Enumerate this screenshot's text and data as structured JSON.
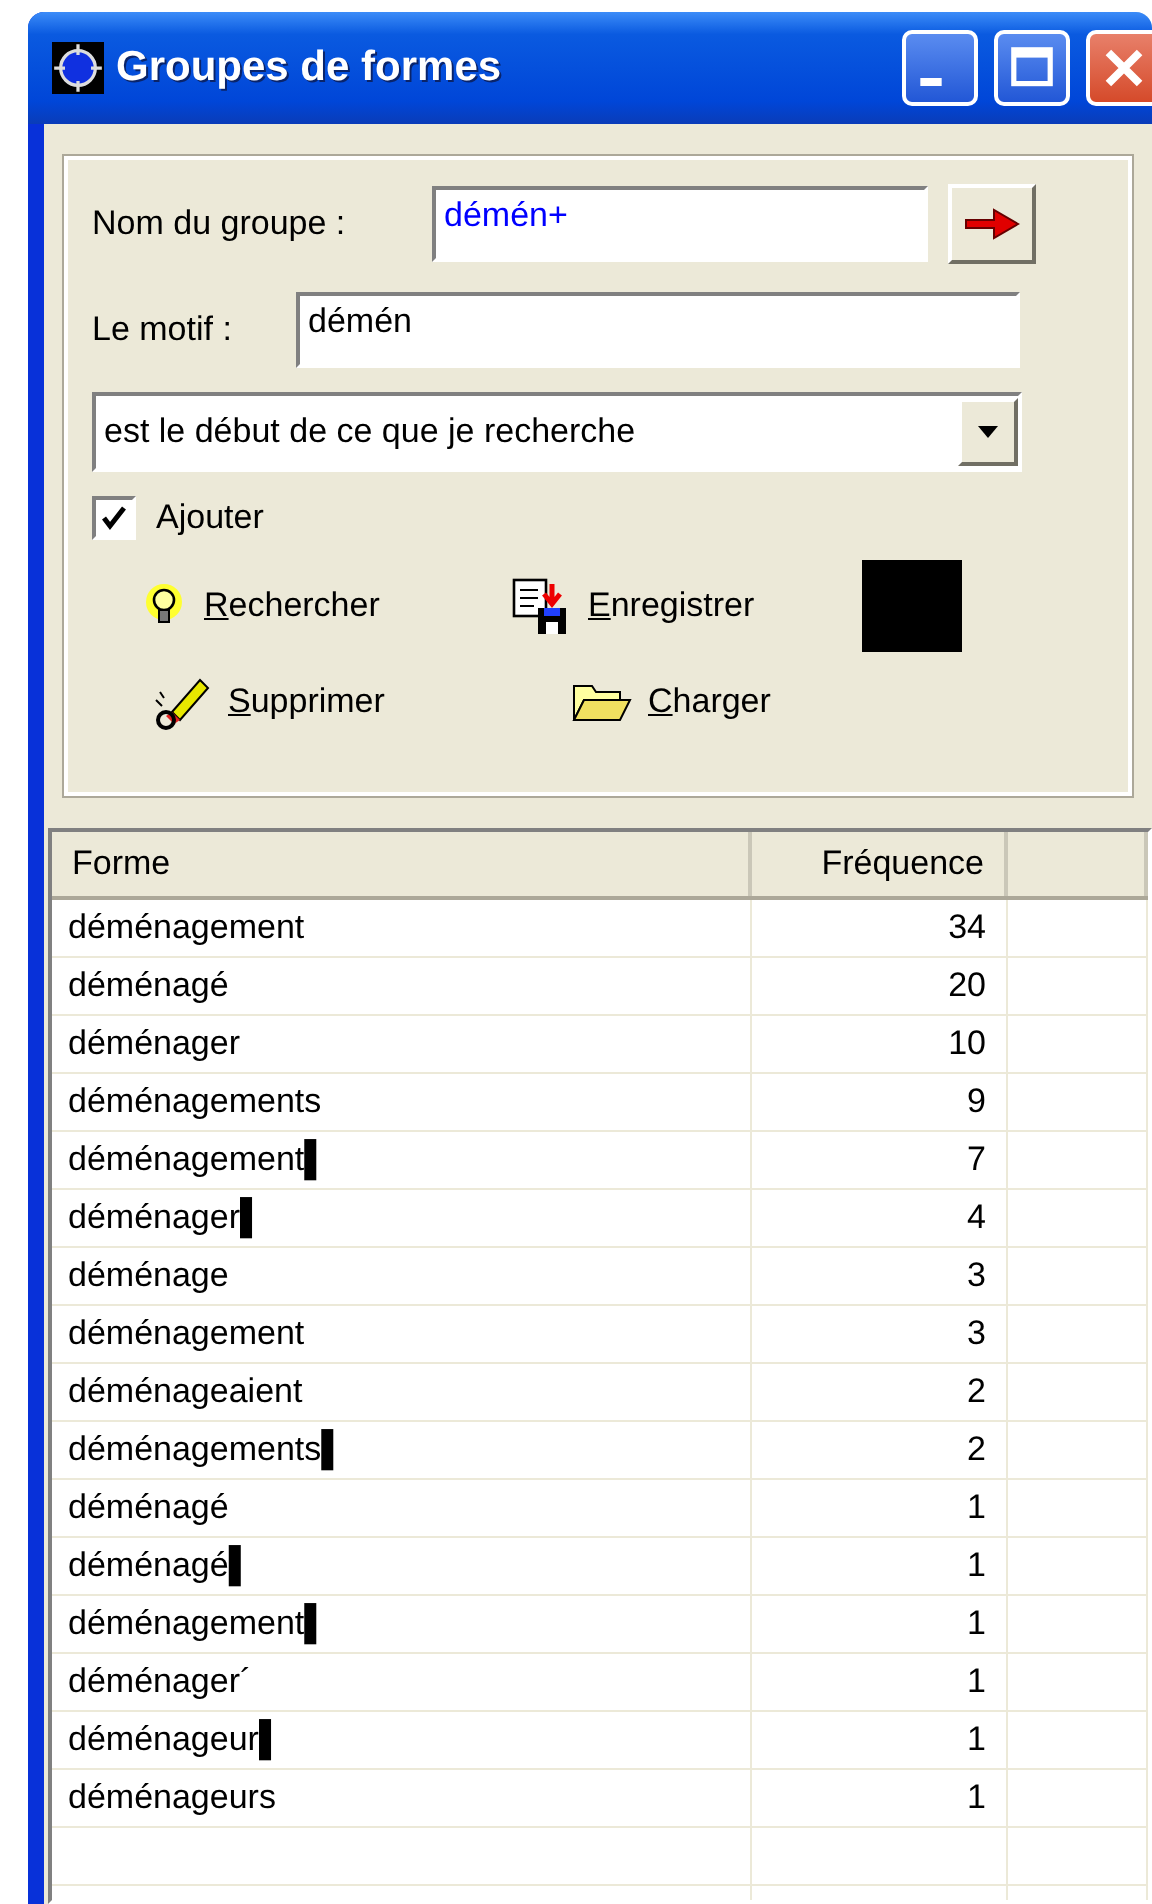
{
  "window": {
    "title": "Groupes de formes"
  },
  "group_name": {
    "label": "Nom du groupe :",
    "value": "démén+"
  },
  "pattern": {
    "label": "Le motif :",
    "value": "démén"
  },
  "match_mode": {
    "value": "est le début de ce que je recherche"
  },
  "add": {
    "label": "Ajouter",
    "checked": true
  },
  "actions": [
    {
      "kind": "search",
      "label": "Rechercher"
    },
    {
      "kind": "save",
      "label": "Enregistrer"
    },
    {
      "kind": "delete",
      "label": "Supprimer"
    },
    {
      "kind": "load",
      "label": "Charger"
    }
  ],
  "swatch": {
    "color": "#000000"
  },
  "table": {
    "columns": [
      "Forme",
      "Fréquence"
    ],
    "rows": [
      [
        "déménagement",
        "34"
      ],
      [
        "déménagé",
        "20"
      ],
      [
        "déménager",
        "10"
      ],
      [
        "déménagements",
        "9"
      ],
      [
        "déménagement▌",
        "7"
      ],
      [
        "déménager▌",
        "4"
      ],
      [
        "déménage",
        "3"
      ],
      [
        "déménagement",
        "3"
      ],
      [
        "déménageaient",
        "2"
      ],
      [
        "déménagements▌",
        "2"
      ],
      [
        "déménagé",
        "1"
      ],
      [
        "déménagé▌",
        "1"
      ],
      [
        "déménagement▌",
        "1"
      ],
      [
        "déménager´",
        "1"
      ],
      [
        "déménageur▌",
        "1"
      ],
      [
        "déménageurs",
        "1"
      ]
    ]
  }
}
